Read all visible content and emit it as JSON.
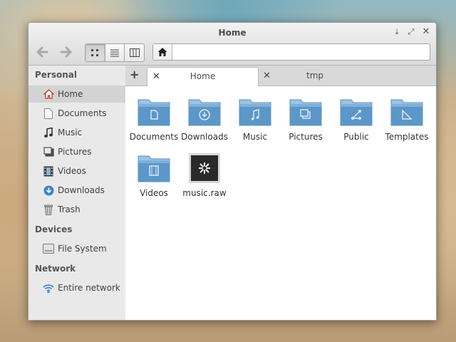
{
  "window": {
    "title": "Home"
  },
  "titlebar": {
    "buttons": [
      "download-icon",
      "maximize-icon",
      "close-icon"
    ]
  },
  "toolbar": {
    "back_icon": "arrow-left-icon",
    "forward_icon": "arrow-right-icon",
    "views": [
      "icon-view",
      "list-view",
      "column-view"
    ],
    "active_view": "icon-view"
  },
  "pathbar": {
    "crumb_icon": "home-icon"
  },
  "sidebar": {
    "sections": [
      {
        "title": "Personal",
        "items": [
          {
            "label": "Home",
            "icon": "home-icon",
            "selected": true
          },
          {
            "label": "Documents",
            "icon": "document-icon"
          },
          {
            "label": "Music",
            "icon": "music-note-icon"
          },
          {
            "label": "Pictures",
            "icon": "pictures-icon"
          },
          {
            "label": "Videos",
            "icon": "film-icon"
          },
          {
            "label": "Downloads",
            "icon": "download-circle-icon"
          },
          {
            "label": "Trash",
            "icon": "trash-icon"
          }
        ]
      },
      {
        "title": "Devices",
        "items": [
          {
            "label": "File System",
            "icon": "drive-icon"
          }
        ]
      },
      {
        "title": "Network",
        "items": [
          {
            "label": "Entire network",
            "icon": "wifi-icon"
          }
        ]
      }
    ]
  },
  "tabs": [
    {
      "label": "Home",
      "active": true
    },
    {
      "label": "tmp",
      "active": false
    }
  ],
  "new_tab_label": "+",
  "files": [
    {
      "label": "Documents",
      "icon": "folder-documents-icon"
    },
    {
      "label": "Downloads",
      "icon": "folder-downloads-icon"
    },
    {
      "label": "Music",
      "icon": "folder-music-icon"
    },
    {
      "label": "Pictures",
      "icon": "folder-pictures-icon"
    },
    {
      "label": "Public",
      "icon": "folder-public-icon"
    },
    {
      "label": "Templates",
      "icon": "folder-templates-icon"
    },
    {
      "label": "Videos",
      "icon": "folder-videos-icon"
    },
    {
      "label": "music.raw",
      "icon": "raw-file-icon"
    }
  ],
  "colors": {
    "folder": "#5b97c8",
    "folder_light": "#9cc3e3",
    "accent": "#3b86c9"
  }
}
